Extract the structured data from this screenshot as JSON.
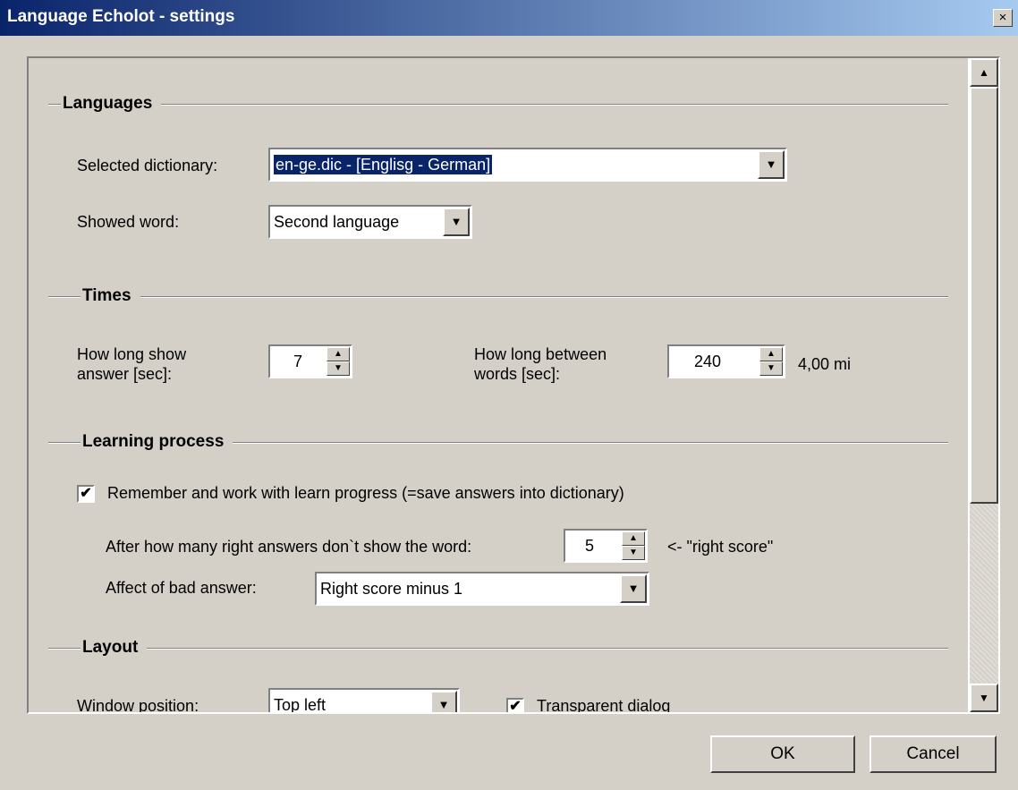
{
  "window": {
    "title": "Language Echolot - settings",
    "close_symbol": "×"
  },
  "sections": {
    "languages": "Languages",
    "times": "Times",
    "learning": "Learning process",
    "layout": "Layout"
  },
  "languages": {
    "dictionary_label": "Selected dictionary:",
    "dictionary_value": "en-ge.dic - [Englisg - German]",
    "showed_word_label": "Showed word:",
    "showed_word_value": "Second language"
  },
  "times": {
    "show_answer_label_1": "How long show",
    "show_answer_label_2": "answer [sec]:",
    "show_answer_value": "7",
    "between_words_label_1": "How long between",
    "between_words_label_2": "words [sec]:",
    "between_words_value": "240",
    "between_words_minutes": "4,00 mi"
  },
  "learning": {
    "remember_checkbox_label": "Remember and work with learn progress (=save answers into dictionary)",
    "remember_checked": true,
    "right_answers_label": "After how many right answers don`t show the word:",
    "right_answers_value": "5",
    "right_score_hint": "<- \"right score\"",
    "bad_answer_label": "Affect of bad answer:",
    "bad_answer_value": "Right score minus 1"
  },
  "layout": {
    "window_position_label": "Window position:",
    "window_position_value": "Top left",
    "transparent_dialog_label": "Transparent dialog",
    "transparent_checked": true
  },
  "buttons": {
    "ok": "OK",
    "cancel": "Cancel"
  },
  "icons": {
    "dropdown": "▼",
    "up": "▲",
    "down": "▼",
    "check": "✔"
  }
}
